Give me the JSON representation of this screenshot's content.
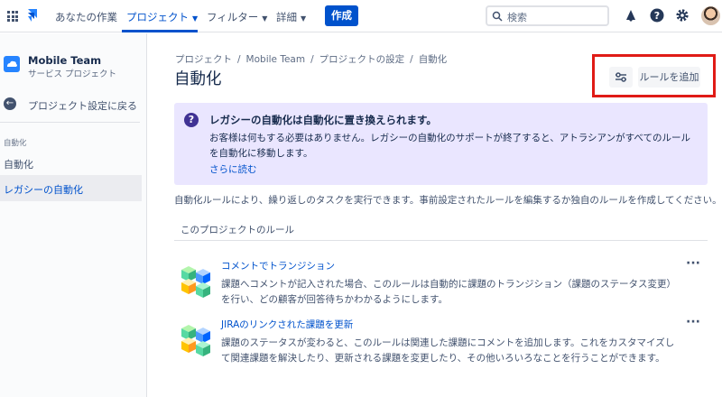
{
  "topnav": {
    "your_work": "あなたの作業",
    "projects": "プロジェクト",
    "filters": "フィルター",
    "details": "詳細",
    "create": "作成",
    "search_placeholder": "検索"
  },
  "sidebar": {
    "project_name": "Mobile Team",
    "project_type": "サービス プロジェクト",
    "back_label": "プロジェクト設定に戻る",
    "section_label": "自動化",
    "items": [
      {
        "label": "自動化"
      },
      {
        "label": "レガシーの自動化"
      }
    ]
  },
  "breadcrumb": [
    "プロジェクト",
    "Mobile Team",
    "プロジェクトの設定",
    "自動化"
  ],
  "page_title": "自動化",
  "add_rule_label": "ルールを追加",
  "info": {
    "title": "レガシーの自動化は自動化に置き換えられます。",
    "body": "お客様は何もする必要はありません。レガシーの自動化のサポートが終了すると、アトラシアンがすべてのルールを自動化に移動します。",
    "link": "さらに読む"
  },
  "description": "自動化ルールにより、繰り返しのタスクを実行できます。事前設定されたルールを編集するか独自のルールを作成してください。",
  "rules_heading": "このプロジェクトのルール",
  "rules": [
    {
      "title": "コメントでトランジション",
      "description": "課題へコメントが記入された場合、このルールは自動的に課題のトランジション（課題のステータス変更）を行い、どの顧客が回答待ちかわかるようにします。"
    },
    {
      "title": "JIRAのリンクされた課題を更新",
      "description": "課題のステータスが変わると、このルールは関連した課題にコメントを追加します。これをカスタマイズして関連課題を解決したり、更新される課題を変更したり、その他いろいろなことを行うことができます。"
    }
  ],
  "colors": {
    "primary": "#0052cc",
    "info_bg": "#eae6ff",
    "info_icon": "#403294",
    "highlight": "#e01b16"
  }
}
